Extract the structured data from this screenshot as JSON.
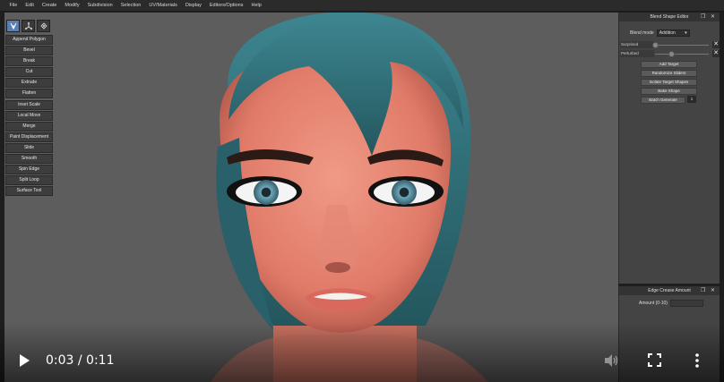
{
  "menu": [
    "File",
    "Edit",
    "Create",
    "Modify",
    "Subdivision",
    "Selection",
    "UV/Materials",
    "Display",
    "Editors/Options",
    "Help"
  ],
  "tools": {
    "icons": [
      "select-mode-icon",
      "transform-icon",
      "pattern-icon"
    ],
    "buttons": [
      "Append Polygon",
      "Bevel",
      "Break",
      "Cut",
      "Extrude",
      "Flatten",
      "Inset Scale",
      "Local Move",
      "Merge",
      "Paint Displacement",
      "Slide",
      "Smooth",
      "Spin Edge",
      "Split Loop",
      "Surface Tool"
    ]
  },
  "blend_shape_editor": {
    "title": "Blend Shape Editor",
    "panel_controls": "❐ ✕",
    "blend_mode_label": "Blend mode",
    "blend_mode_value": "Addition",
    "shapes": [
      {
        "label": "Surprised",
        "value": 0.0
      },
      {
        "label": "Perturbed",
        "value": 0.3
      }
    ],
    "delete_glyph": "✕",
    "buttons": [
      "Add Target",
      "Randomize Sliders",
      "Isolate Target Shapes",
      "Bake Shape",
      "Batch Generate"
    ],
    "batch_count": "1"
  },
  "edge_crease": {
    "title": "Edge Crease Amount",
    "panel_controls": "❐ ✕",
    "amount_label": "Amount (0-10)"
  },
  "player": {
    "time": "0:03 / 0:11",
    "progress": 0.27
  },
  "colors": {
    "viewport_bg": "#5d5d5d",
    "hair": "#2f6f78",
    "skin": "#e2806e",
    "iris": "#5a8fa3",
    "active_tool": "#5b7fb3"
  }
}
